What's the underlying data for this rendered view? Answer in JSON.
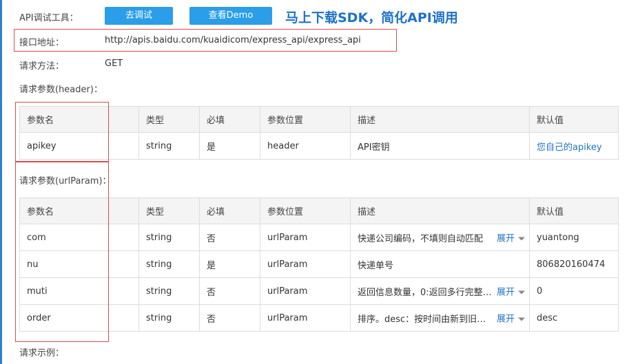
{
  "api": {
    "tool_label": "API调试工具：",
    "debug_button": "去调试",
    "demo_button": "查看Demo",
    "promo_text": "马上下载SDK，简化API调用",
    "address_label": "接口地址：",
    "address_value": "http://apis.baidu.com/kuaidicom/express_api/express_api",
    "method_label": "请求方法：",
    "method_value": "GET",
    "header_params_label": "请求参数(header)：",
    "url_params_label": "请求参数(urlParam)：",
    "example_label": "请求示例："
  },
  "columns": [
    "参数名",
    "类型",
    "必填",
    "参数位置",
    "描述",
    "默认值"
  ],
  "header_rows": [
    {
      "name": "apikey",
      "type": "string",
      "required": "是",
      "position": "header",
      "desc": "API密钥",
      "default": "您自己的apikey"
    }
  ],
  "url_rows": [
    {
      "name": "com",
      "type": "string",
      "required": "否",
      "position": "urlParam",
      "desc": "快递公司编码，不填则自动匹配",
      "expand": "展开",
      "default": "yuantong"
    },
    {
      "name": "nu",
      "type": "string",
      "required": "是",
      "position": "urlParam",
      "desc": "快递单号",
      "expand": "",
      "default": "806820160474"
    },
    {
      "name": "muti",
      "type": "string",
      "required": "否",
      "position": "urlParam",
      "desc": "返回信息数量，0:返回多行完整的...",
      "expand": "展开",
      "default": "0"
    },
    {
      "name": "order",
      "type": "string",
      "required": "否",
      "position": "urlParam",
      "desc": "排序。desc：按时间由新到旧排...",
      "expand": "展开",
      "default": "desc"
    }
  ],
  "colors": {
    "accent": "#2a9ee8",
    "highlight_border": "#e0494c",
    "link": "#1e72c8"
  }
}
